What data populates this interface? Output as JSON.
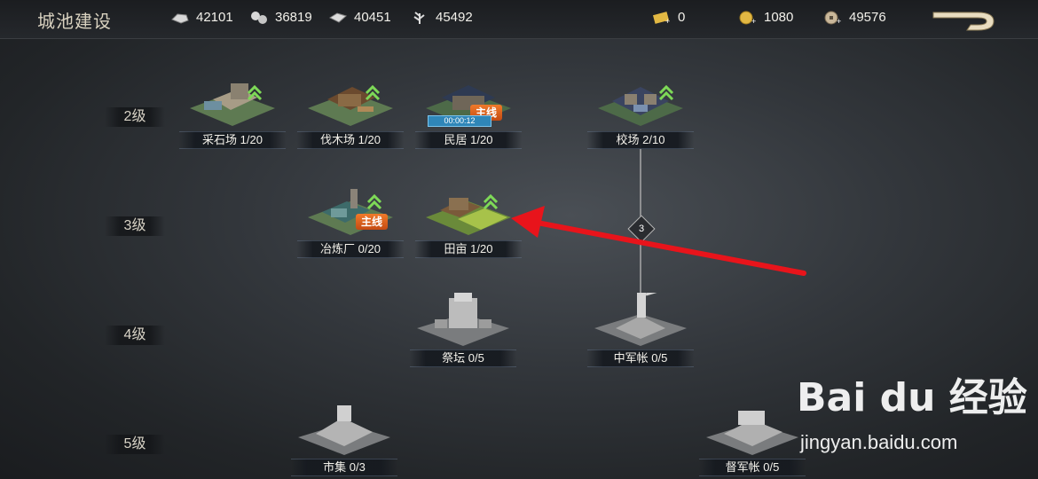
{
  "header": {
    "title": "城池建设",
    "resources": [
      {
        "icon": "stone-icon",
        "value": "42101"
      },
      {
        "icon": "wood-icon",
        "value": "36819"
      },
      {
        "icon": "iron-icon",
        "value": "40451"
      },
      {
        "icon": "grain-icon",
        "value": "45492"
      }
    ],
    "currencies": [
      {
        "icon": "gold-ticket-icon",
        "value": "0"
      },
      {
        "icon": "gold-coin-icon",
        "value": "1080"
      },
      {
        "icon": "copper-coin-icon",
        "value": "49576"
      }
    ]
  },
  "levels": [
    "2级",
    "3级",
    "4级",
    "5级"
  ],
  "buildings": {
    "quarry": {
      "label": "采石场 1/20"
    },
    "lumber": {
      "label": "伐木场 1/20"
    },
    "residence": {
      "label": "民居 1/20",
      "tag": "主线",
      "timer": "00:00:12"
    },
    "drill_ground": {
      "label": "校场 2/10"
    },
    "smelter": {
      "label": "冶炼厂 0/20",
      "tag": "主线"
    },
    "farmland": {
      "label": "田亩 1/20"
    },
    "altar": {
      "label": "祭坛 0/5"
    },
    "command_tent": {
      "label": "中军帐 0/5"
    },
    "market": {
      "label": "市集 0/3"
    },
    "governor_tent": {
      "label": "督军帐 0/5"
    }
  },
  "connector": {
    "value": "3"
  },
  "watermark": {
    "logo": "Bai du 经验",
    "url": "jingyan.baidu.com"
  },
  "colors": {
    "accent_arrow": "#e8141b",
    "tag_orange": "#e0641e",
    "upgrade_green": "#7ed957"
  }
}
